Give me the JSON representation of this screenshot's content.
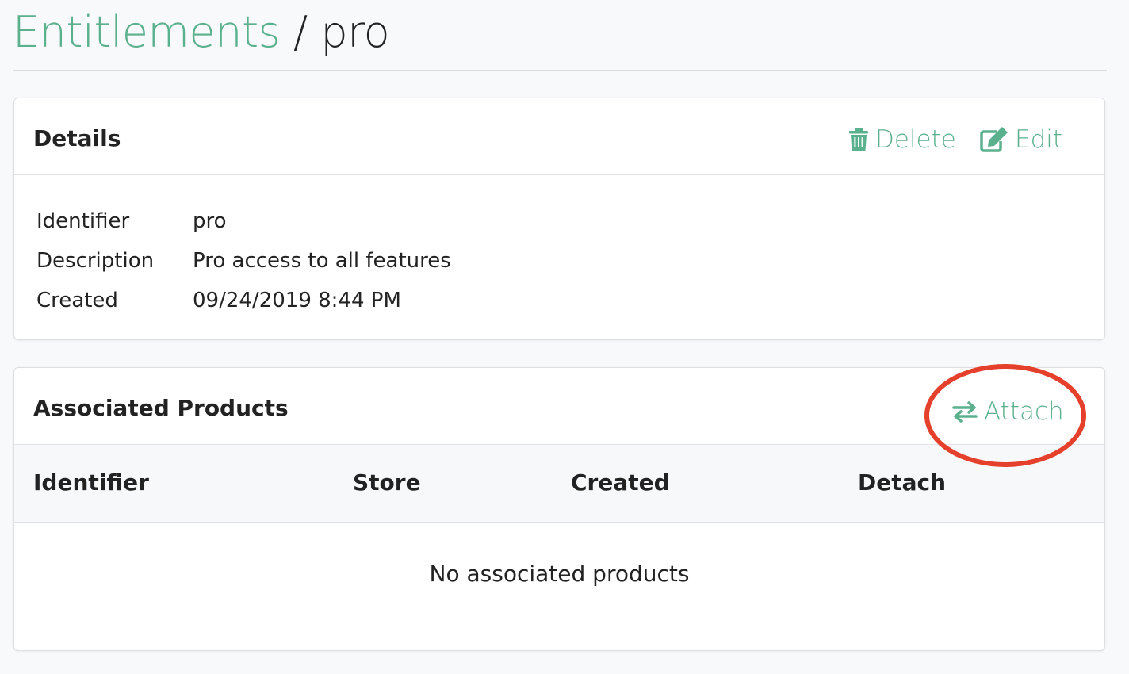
{
  "breadcrumb": {
    "parent": "Entitlements",
    "separator": "/",
    "current": "pro"
  },
  "details": {
    "title": "Details",
    "actions": {
      "delete_label": "Delete",
      "edit_label": "Edit"
    },
    "fields": [
      {
        "label": "Identifier",
        "value": "pro"
      },
      {
        "label": "Description",
        "value": "Pro access to all features"
      },
      {
        "label": "Created",
        "value": "09/24/2019 8:44 PM"
      }
    ]
  },
  "associated_products": {
    "title": "Associated Products",
    "attach_label": "Attach",
    "columns": [
      "Identifier",
      "Store",
      "Created",
      "Detach"
    ],
    "empty_message": "No associated products"
  },
  "icons": {
    "delete": "trash-icon",
    "edit": "edit-icon",
    "attach": "exchange-arrows-icon"
  },
  "colors": {
    "accent": "#5bb08d",
    "annotation": "#e5402b",
    "background": "#f8f9fb",
    "text": "#222222"
  }
}
